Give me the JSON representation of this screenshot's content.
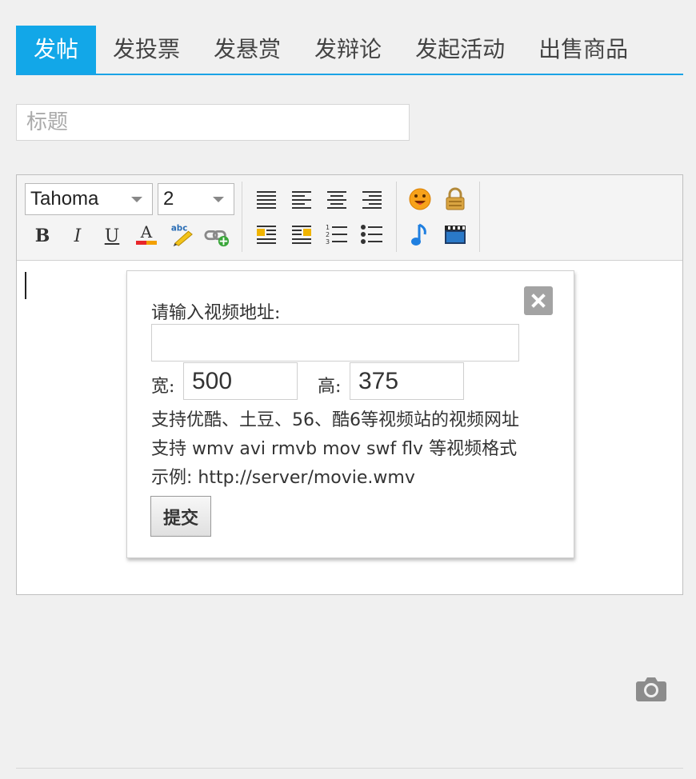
{
  "tabs": [
    {
      "label": "发帖",
      "active": true
    },
    {
      "label": "发投票",
      "active": false
    },
    {
      "label": "发悬赏",
      "active": false
    },
    {
      "label": "发辩论",
      "active": false
    },
    {
      "label": "发起活动",
      "active": false
    },
    {
      "label": "出售商品",
      "active": false
    }
  ],
  "title_field": {
    "placeholder": "标题",
    "value": ""
  },
  "toolbar": {
    "font_family": "Tahoma",
    "font_size": "2",
    "icons": [
      "bold-icon",
      "italic-icon",
      "underline-icon",
      "font-color-icon",
      "spellcheck-icon",
      "insert-link-icon",
      "align-justify-icon",
      "align-left-icon",
      "align-center-icon",
      "align-right-icon",
      "float-left-image-icon",
      "float-right-image-icon",
      "ordered-list-icon",
      "unordered-list-icon",
      "smiley-icon",
      "lock-icon",
      "music-icon",
      "video-icon"
    ]
  },
  "video_dialog": {
    "prompt": "请输入视频地址:",
    "url_value": "",
    "width_label": "宽:",
    "width_value": "500",
    "height_label": "高:",
    "height_value": "375",
    "info_line1": "支持优酷、土豆、56、酷6等视频站的视频网址",
    "info_line2": "支持 wmv avi rmvb mov swf flv 等视频格式",
    "info_line3": "示例: http://server/movie.wmv",
    "submit_label": "提交"
  },
  "colors": {
    "accent": "#12a7e8",
    "background": "#f0f0f0"
  }
}
